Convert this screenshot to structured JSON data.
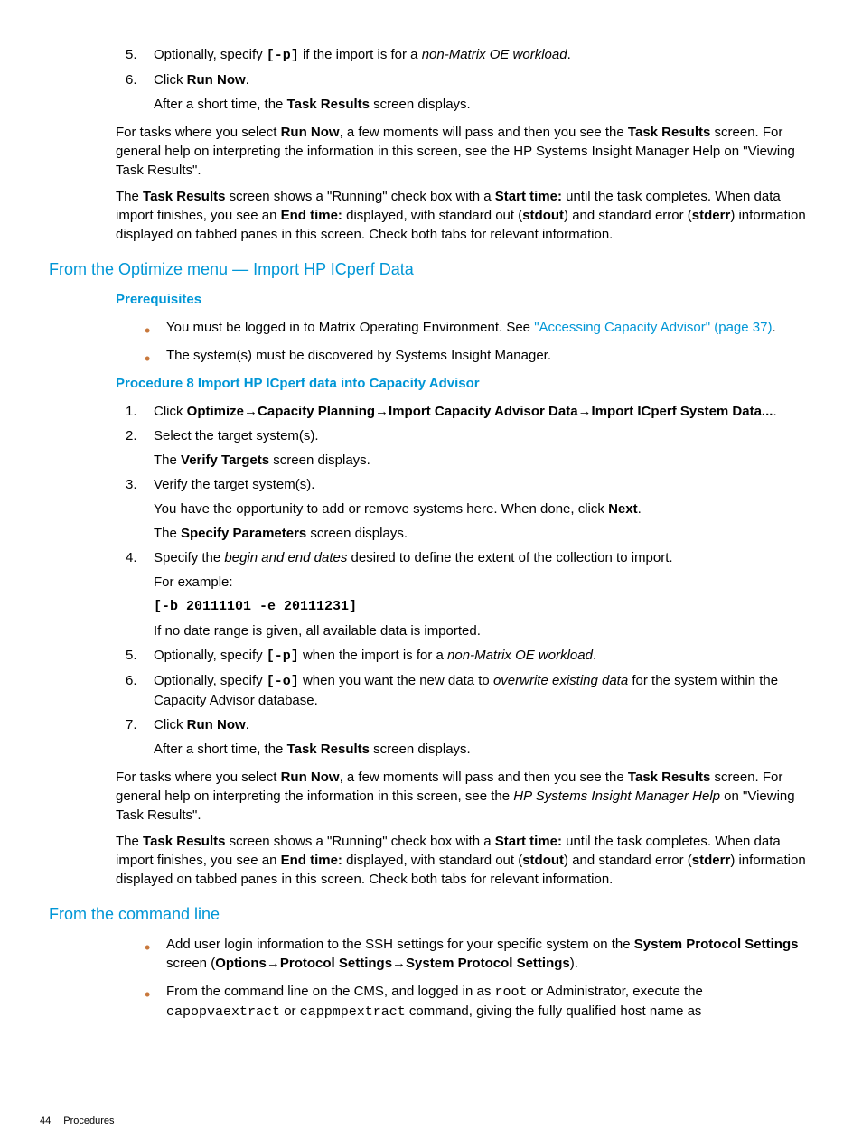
{
  "top_list": {
    "item5": {
      "t1": "Optionally, specify ",
      "code": "[-p]",
      "t2": " if the import is for a ",
      "italic": "non-Matrix OE workload",
      "t3": "."
    },
    "item6": {
      "t1": "Click ",
      "bold": "Run Now",
      "t2": ".",
      "sub1a": "After a short time, the ",
      "sub1b": "Task Results",
      "sub1c": " screen displays."
    }
  },
  "para1": {
    "t1": "For tasks where you select ",
    "b1": "Run Now",
    "t2": ", a few moments will pass and then you see the ",
    "b2": "Task Results",
    "t3": " screen. For general help on interpreting the information in this screen, see the HP Systems Insight Manager Help on \"Viewing Task Results\"."
  },
  "para2": {
    "t1": "The ",
    "b1": "Task Results",
    "t2": " screen shows a \"Running\" check box with a ",
    "b2": "Start time:",
    "t3": " until the task completes. When data import finishes, you see an ",
    "b3": "End time:",
    "t4": " displayed, with standard out (",
    "b4": "stdout",
    "t5": ") and standard error (",
    "b5": "stderr",
    "t6": ") information displayed on tabbed panes in this screen. Check both tabs for relevant information."
  },
  "h2_optimize": "From the Optimize menu — Import HP ICperf Data",
  "h3_prereq": "Prerequisites",
  "prereq_items": {
    "i1": {
      "t1": "You must be logged in to Matrix Operating Environment. See ",
      "link": "\"Accessing Capacity Advisor\" (page 37)",
      "t2": "."
    },
    "i2": "The system(s) must be discovered by Systems Insight Manager."
  },
  "h3_proc8": "Procedure 8 Import HP ICperf data into Capacity Advisor",
  "proc_list": {
    "i1": {
      "t1": "Click ",
      "b1": "Optimize",
      "arrow": "→",
      "b2": "Capacity Planning",
      "b3": "Import Capacity Advisor Data",
      "b4": "Import ICperf System Data...",
      "t2": "."
    },
    "i2": {
      "t1": "Select the target system(s).",
      "s1a": "The ",
      "s1b": "Verify Targets",
      "s1c": " screen displays."
    },
    "i3": {
      "t1": "Verify the target system(s).",
      "s1a": "You have the opportunity to add or remove systems here. When done, click ",
      "s1b": "Next",
      "s1c": ".",
      "s2a": "The ",
      "s2b": "Specify Parameters",
      "s2c": " screen displays."
    },
    "i4": {
      "t1": "Specify the ",
      "it1": "begin and end dates",
      "t2": " desired to define the extent of the collection to import.",
      "s1": "For example:",
      "code": "[-b 20111101 -e 20111231]",
      "s2": "If no date range is given, all available data is imported."
    },
    "i5": {
      "t1": "Optionally, specify ",
      "code": "[-p]",
      "t2": " when the import is for a ",
      "it1": "non-Matrix OE workload",
      "t3": "."
    },
    "i6": {
      "t1": "Optionally, specify ",
      "code": "[-o]",
      "t2": " when you want the new data to ",
      "it1": "overwrite existing data",
      "t3": " for the system within the Capacity Advisor database."
    },
    "i7": {
      "t1": "Click ",
      "b1": "Run Now",
      "t2": ".",
      "s1a": "After a short time, the ",
      "s1b": "Task Results",
      "s1c": " screen displays."
    }
  },
  "para3": {
    "t1": "For tasks where you select ",
    "b1": "Run Now",
    "t2": ", a few moments will pass and then you see the ",
    "b2": "Task Results",
    "t3": " screen. For general help on interpreting the information in this screen, see the ",
    "it1": "HP Systems Insight Manager Help",
    "t4": " on \"Viewing Task Results\"."
  },
  "para4": {
    "t1": "The ",
    "b1": "Task Results",
    "t2": " screen shows a \"Running\" check box with a ",
    "b2": "Start time:",
    "t3": " until the task completes. When data import finishes, you see an ",
    "b3": "End time:",
    "t4": " displayed, with standard out (",
    "b4": "stdout",
    "t5": ") and standard error (",
    "b5": "stderr",
    "t6": ") information displayed on tabbed panes in this screen. Check both tabs for relevant information."
  },
  "h2_cmdline": "From the command line",
  "cmd_items": {
    "i1": {
      "t1": "Add user login information to the SSH settings for your specific system on the ",
      "b1": "System Protocol Settings",
      "t2": " screen (",
      "b2": "Options",
      "arrow": "→",
      "b3": "Protocol Settings",
      "b4": "System Protocol Settings",
      "t3": ")."
    },
    "i2": {
      "t1": "From the command line on the CMS, and logged in as ",
      "c1": "root",
      "t2": " or Administrator, execute the ",
      "c2": "capopvaextract",
      "t3": " or ",
      "c3": "cappmpextract",
      "t4": " command, giving the fully qualified host name as"
    }
  },
  "footer": {
    "page": "44",
    "section": "Procedures"
  }
}
